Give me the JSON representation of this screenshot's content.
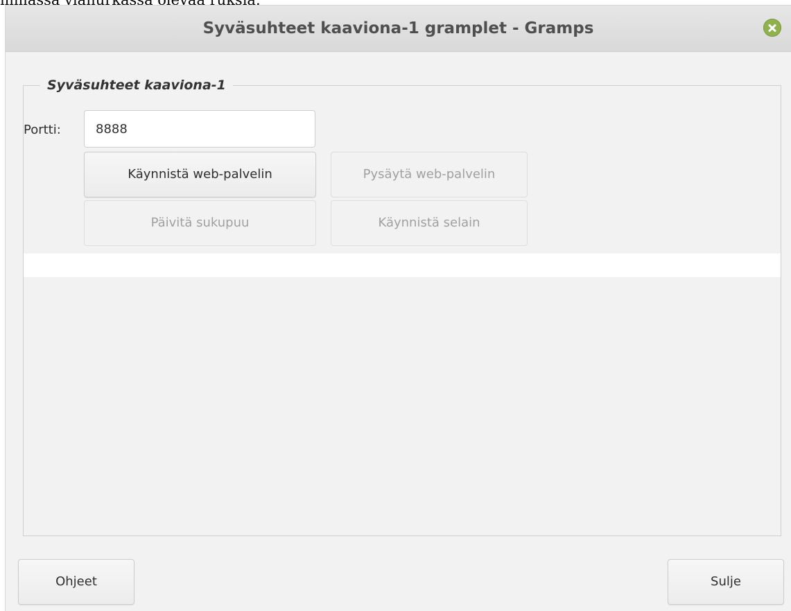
{
  "page_fragment": "mmassa ylänurkassa olevaa ruksia.",
  "window": {
    "title": "Syväsuhteet kaaviona-1 gramplet - Gramps"
  },
  "frame": {
    "label": "Syväsuhteet kaaviona-1"
  },
  "port": {
    "label": "Portti:",
    "value": "8888"
  },
  "buttons": {
    "start_server": "Käynnistä web-palvelin",
    "stop_server": "Pysäytä web-palvelin",
    "update_tree": "Päivitä sukupuu",
    "start_browser": "Käynnistä selain",
    "help": "Ohjeet",
    "close": "Sulje"
  },
  "colors": {
    "close_icon": "#8fb24f",
    "window_bg": "#f2f2f2",
    "disabled_text": "#a0a0a0"
  }
}
